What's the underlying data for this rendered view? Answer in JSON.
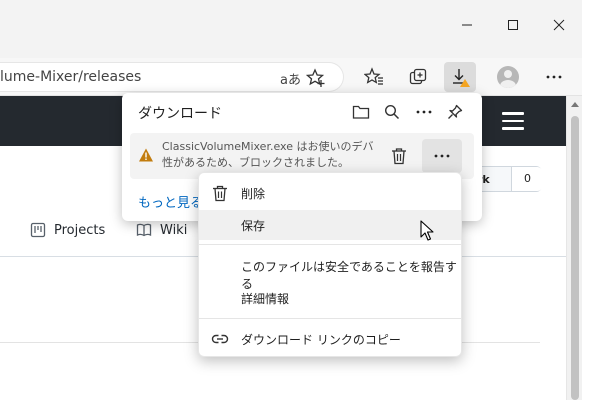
{
  "browser": {
    "url_text": "lume-Mixer/releases",
    "read_aloud_label": "aあ",
    "window_controls": {
      "minimize": "—",
      "maximize": "□",
      "close": "✕"
    }
  },
  "github": {
    "fork_label": "rk",
    "fork_count": "0",
    "tabs": [
      {
        "label": "Projects",
        "icon": "project-board-icon"
      },
      {
        "label": "Wiki",
        "icon": "book-icon"
      }
    ]
  },
  "downloads": {
    "title": "ダウンロード",
    "item": {
      "message_line1": "ClassicVolumeMixer.exe はお使いのデバイス",
      "message_line2": "性があるため、ブロックされました。"
    },
    "see_more": "もっと見る"
  },
  "context_menu": {
    "items": [
      {
        "label": "削除",
        "icon": "trash-icon"
      },
      {
        "label": "保存",
        "icon": ""
      },
      {
        "label": "このファイルは安全であることを報告する",
        "icon": ""
      },
      {
        "label": "詳細情報",
        "icon": ""
      },
      {
        "label": "ダウンロード リンクのコピー",
        "icon": "link-icon"
      }
    ],
    "hovered_index": 1
  },
  "colors": {
    "github_header": "#24292f",
    "link_blue": "#0067c0",
    "warning": "#c27c0e",
    "download_badge": "#f5a623"
  }
}
